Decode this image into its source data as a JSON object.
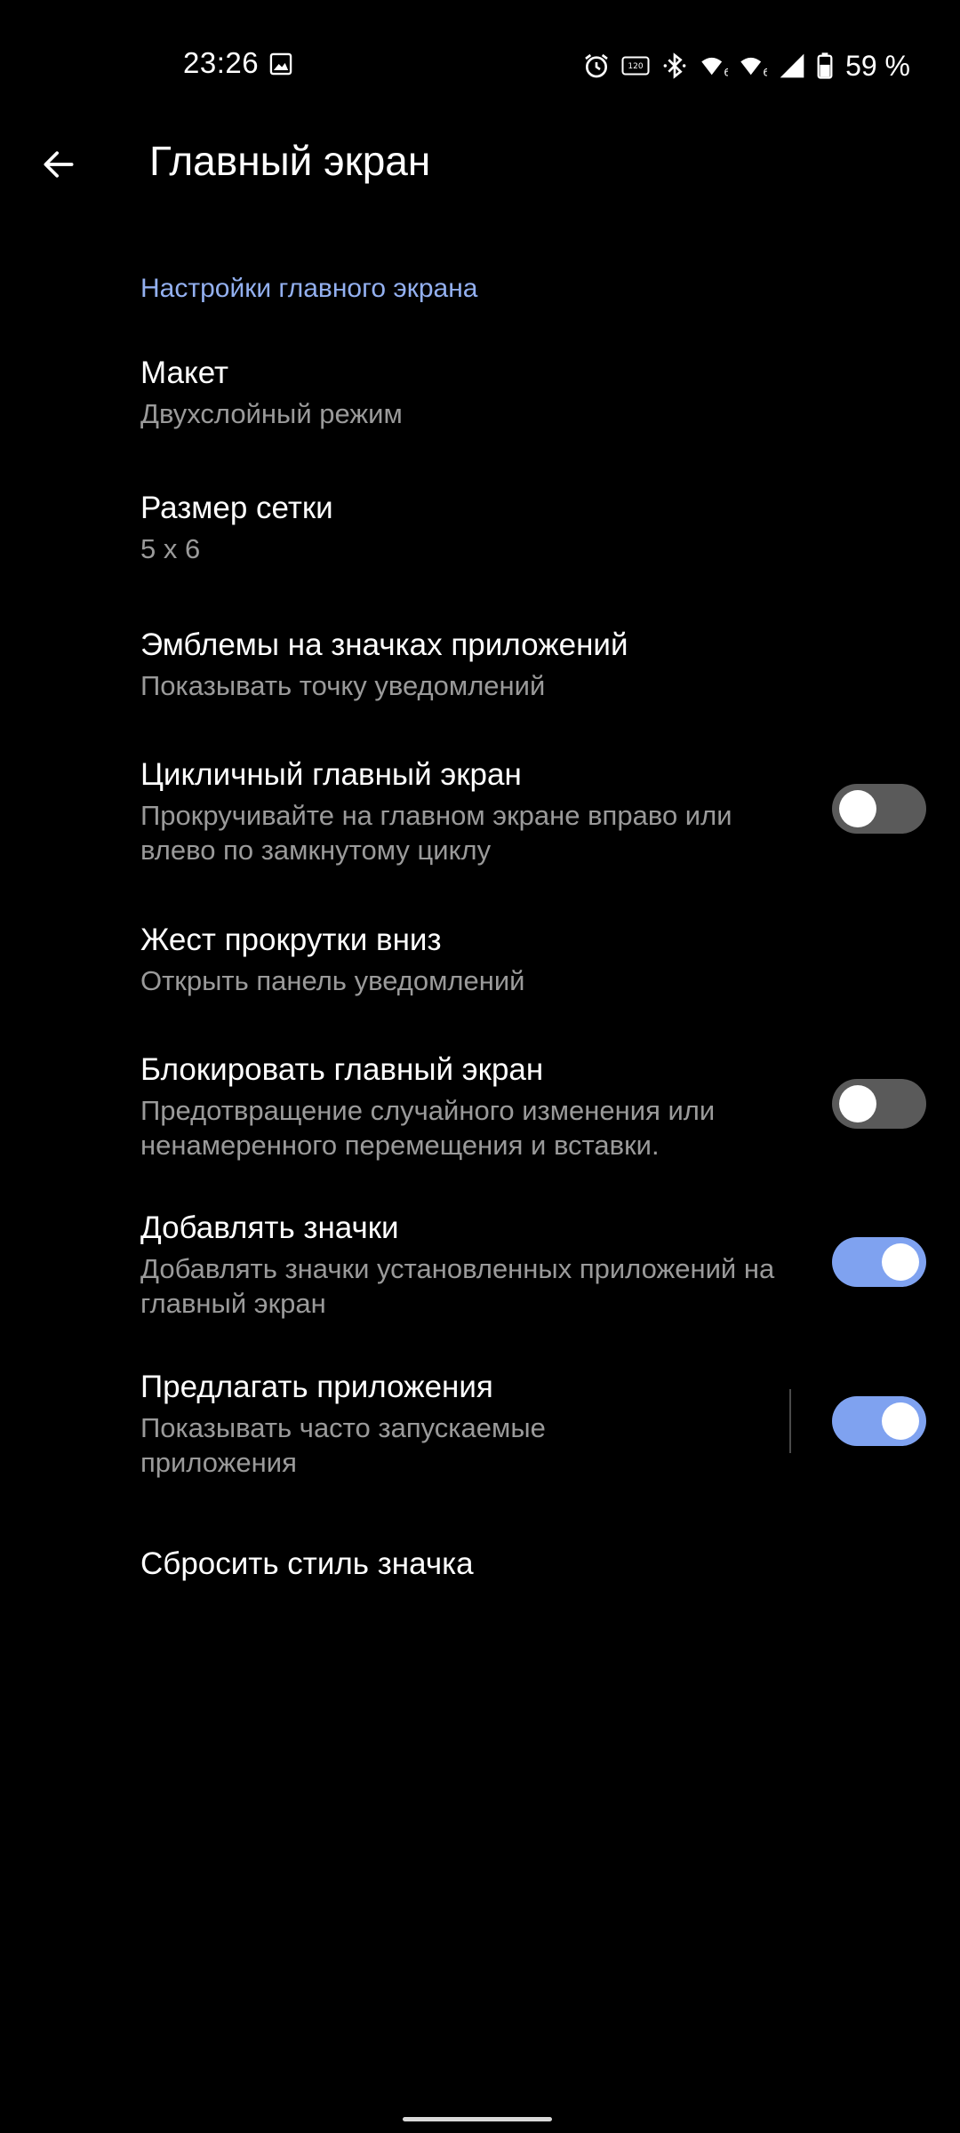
{
  "status_bar": {
    "time": "23:26",
    "gallery_notification_icon": "image-icon",
    "icons": [
      "alarm-icon",
      "refresh-rate-120hz-icon",
      "bluetooth-icon",
      "wifi-6-icon",
      "wifi-6-icon",
      "cell-signal-icon",
      "battery-icon"
    ],
    "battery_percent": "59 %"
  },
  "app_bar": {
    "back_icon": "arrow-left-icon",
    "title": "Главный экран"
  },
  "section": {
    "header": "Настройки главного экрана"
  },
  "prefs": [
    {
      "title": "Макет",
      "summary": "Двухслойный режим"
    },
    {
      "title": "Размер сетки",
      "summary": "5 x 6"
    },
    {
      "title": "Эмблемы на значках приложений",
      "summary": "Показывать точку уведомлений"
    },
    {
      "title": "Цикличный главный экран",
      "summary": "Прокручивайте на главном экране вправо или влево по замкнутому циклу",
      "switch": false
    },
    {
      "title": "Жест прокрутки вниз",
      "summary": "Открыть панель уведомлений"
    },
    {
      "title": "Блокировать главный экран",
      "summary": "Предотвращение случайного изменения или ненамеренного перемещения и вставки.",
      "switch": false
    },
    {
      "title": "Добавлять значки",
      "summary": "Добавлять значки установленных приложений на главный экран",
      "switch": true
    },
    {
      "title": "Предлагать приложения",
      "summary": "Показывать часто запускаемые приложения",
      "switch": true
    },
    {
      "title": "Сбросить стиль значка"
    }
  ],
  "colors": {
    "background": "#000000",
    "accent": "#93b0f0",
    "switch_on": "#7fa2f0",
    "switch_off": "#5a5a5a",
    "summary_text": "#9a9a9a"
  }
}
